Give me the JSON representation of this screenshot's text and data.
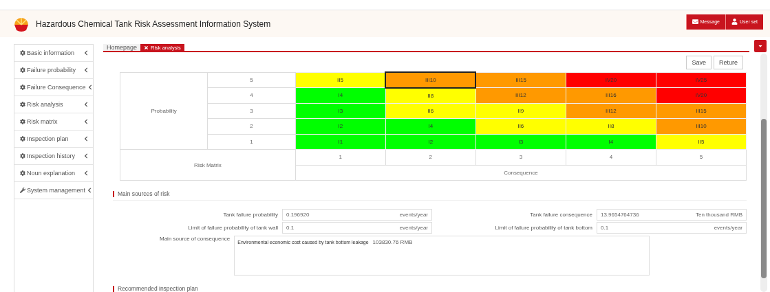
{
  "header": {
    "title": "Hazardous Chemical Tank Risk Assessment Information System",
    "buttons": [
      {
        "kind": "message",
        "label": "Message"
      },
      {
        "kind": "user",
        "label": "User set"
      }
    ]
  },
  "sidebar": {
    "items": [
      {
        "kind": "gear",
        "label": "Basic information"
      },
      {
        "kind": "gear",
        "label": "Failure probability"
      },
      {
        "kind": "gear",
        "label": "Failure Consequence"
      },
      {
        "kind": "gear",
        "label": "Risk analysis"
      },
      {
        "kind": "gear",
        "label": "Risk matrix"
      },
      {
        "kind": "gear",
        "label": "Inspection plan"
      },
      {
        "kind": "gear",
        "label": "Inspection history"
      },
      {
        "kind": "gear",
        "label": "Noun explanation"
      },
      {
        "kind": "wrench",
        "label": "System management"
      }
    ]
  },
  "tabs": [
    {
      "label": "Homepage",
      "selected": false,
      "closable": false
    },
    {
      "label": "Risk analysis",
      "selected": true,
      "closable": true
    }
  ],
  "actions": [
    "Save",
    "Reture"
  ],
  "matrix": {
    "row_header": "Probability",
    "corner": "Risk Matrix",
    "column_header": "Consequence",
    "consequence_levels": [
      "1",
      "2",
      "3",
      "4",
      "5"
    ],
    "rows": [
      {
        "label": "5",
        "cells": [
          {
            "text": "II5",
            "color": "#ffff00",
            "selected": false
          },
          {
            "text": "III10",
            "color": "#ff9900",
            "selected": true
          },
          {
            "text": "III15",
            "color": "#ff9900",
            "selected": false
          },
          {
            "text": "IV20",
            "color": "#ff0000",
            "selected": false
          },
          {
            "text": "IV25",
            "color": "#ff0000",
            "selected": false
          }
        ]
      },
      {
        "label": "4",
        "cells": [
          {
            "text": "I4",
            "color": "#00ff00",
            "selected": false
          },
          {
            "text": "II8",
            "color": "#ffff00",
            "selected": false
          },
          {
            "text": "III12",
            "color": "#ff9900",
            "selected": false
          },
          {
            "text": "III16",
            "color": "#ff9900",
            "selected": false
          },
          {
            "text": "IV20",
            "color": "#ff0000",
            "selected": false
          }
        ]
      },
      {
        "label": "3",
        "cells": [
          {
            "text": "I3",
            "color": "#00ff00",
            "selected": false
          },
          {
            "text": "II6",
            "color": "#ffff00",
            "selected": false
          },
          {
            "text": "II9",
            "color": "#ffff00",
            "selected": false
          },
          {
            "text": "III12",
            "color": "#ff9900",
            "selected": false
          },
          {
            "text": "III15",
            "color": "#ff9900",
            "selected": false
          }
        ]
      },
      {
        "label": "2",
        "cells": [
          {
            "text": "I2",
            "color": "#00ff00",
            "selected": false
          },
          {
            "text": "I4",
            "color": "#00ff00",
            "selected": false
          },
          {
            "text": "II6",
            "color": "#ffff00",
            "selected": false
          },
          {
            "text": "II8",
            "color": "#ffff00",
            "selected": false
          },
          {
            "text": "III10",
            "color": "#ff9900",
            "selected": false
          }
        ]
      },
      {
        "label": "1",
        "cells": [
          {
            "text": "I1",
            "color": "#00ff00",
            "selected": false
          },
          {
            "text": "I2",
            "color": "#00ff00",
            "selected": false
          },
          {
            "text": "I3",
            "color": "#00ff00",
            "selected": false
          },
          {
            "text": "I4",
            "color": "#00ff00",
            "selected": false
          },
          {
            "text": "II5",
            "color": "#ffff00",
            "selected": false
          }
        ]
      }
    ]
  },
  "sections": [
    {
      "title": "Main sources of risk"
    },
    {
      "title": "Recommended inspection plan"
    }
  ],
  "fields": [
    {
      "label": "Tank failure probability",
      "value": "0.196920",
      "unit": "events/year"
    },
    {
      "label": "Tank failure consequence",
      "value": "13.9654764736",
      "unit": "Ten thousand RMB"
    },
    {
      "label": "Limit of failure probability of tank wall",
      "value": "0.1",
      "unit": "events/year"
    },
    {
      "label": "Limit of failure probability of tank bottom",
      "value": "0.1",
      "unit": "events/year"
    }
  ],
  "consequence": {
    "label": "Main source of consequence",
    "description": "Environmental economic cost caused by tank bottom leakage",
    "amount": "103830.76 RMB"
  }
}
